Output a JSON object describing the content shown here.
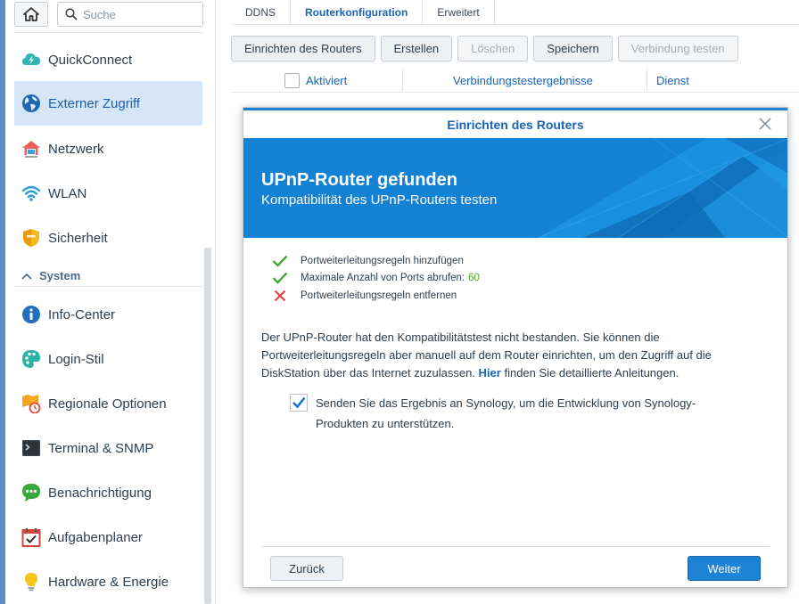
{
  "sidebar": {
    "search_placeholder": "Suche",
    "items": [
      {
        "label": "QuickConnect",
        "icon": "quickconnect-icon"
      },
      {
        "label": "Externer Zugriff",
        "icon": "globe-icon",
        "active": true
      },
      {
        "label": "Netzwerk",
        "icon": "house-icon"
      },
      {
        "label": "WLAN",
        "icon": "wifi-icon"
      },
      {
        "label": "Sicherheit",
        "icon": "shield-icon"
      }
    ],
    "section_label": "System",
    "system_items": [
      {
        "label": "Info-Center",
        "icon": "info-icon"
      },
      {
        "label": "Login-Stil",
        "icon": "palette-icon"
      },
      {
        "label": "Regionale Optionen",
        "icon": "regional-clock-icon"
      },
      {
        "label": "Terminal & SNMP",
        "icon": "terminal-icon"
      },
      {
        "label": "Benachrichtigung",
        "icon": "chat-bubble-icon"
      },
      {
        "label": "Aufgabenplaner",
        "icon": "calendar-check-icon"
      },
      {
        "label": "Hardware & Energie",
        "icon": "lightbulb-icon"
      }
    ]
  },
  "tabs": [
    {
      "label": "DDNS"
    },
    {
      "label": "Routerkonfiguration",
      "active": true
    },
    {
      "label": "Erweitert"
    }
  ],
  "toolbar": {
    "setup": "Einrichten des Routers",
    "create": "Erstellen",
    "delete": "Löschen",
    "save": "Speichern",
    "test": "Verbindung testen"
  },
  "grid": {
    "col_enabled": "Aktiviert",
    "col_results": "Verbindungstestergebnisse",
    "col_service": "Dienst"
  },
  "dialog": {
    "title": "Einrichten des Routers",
    "banner_title": "UPnP-Router gefunden",
    "banner_subtitle": "Kompatibilität des UPnP-Routers testen",
    "checks": [
      {
        "text": "Portweiterleitungsregeln hinzufügen",
        "status": "ok"
      },
      {
        "text": "Maximale Anzahl von Ports abrufen:",
        "value": "60",
        "status": "ok"
      },
      {
        "text": "Portweiterleitungsregeln entfernen",
        "status": "fail"
      }
    ],
    "message_part1": "Der UPnP-Router hat den Kompatibilitätstest nicht bestanden. Sie können die Portweiterleitungsregeln aber manuell auf dem Router einrichten, um den Zugriff auf die DiskStation über das Internet zuzulassen.",
    "message_link": "Hier",
    "message_part2": "finden Sie detaillierte Anleitungen.",
    "send_label": "Senden Sie das Ergebnis an Synology, um die Entwicklung von Synology-Produkten zu unterstützen.",
    "send_checked": true,
    "back": "Zurück",
    "next": "Weiter"
  },
  "colors": {
    "accent": "#1c83d6",
    "ok": "#3aa02c",
    "fail": "#e04040"
  }
}
